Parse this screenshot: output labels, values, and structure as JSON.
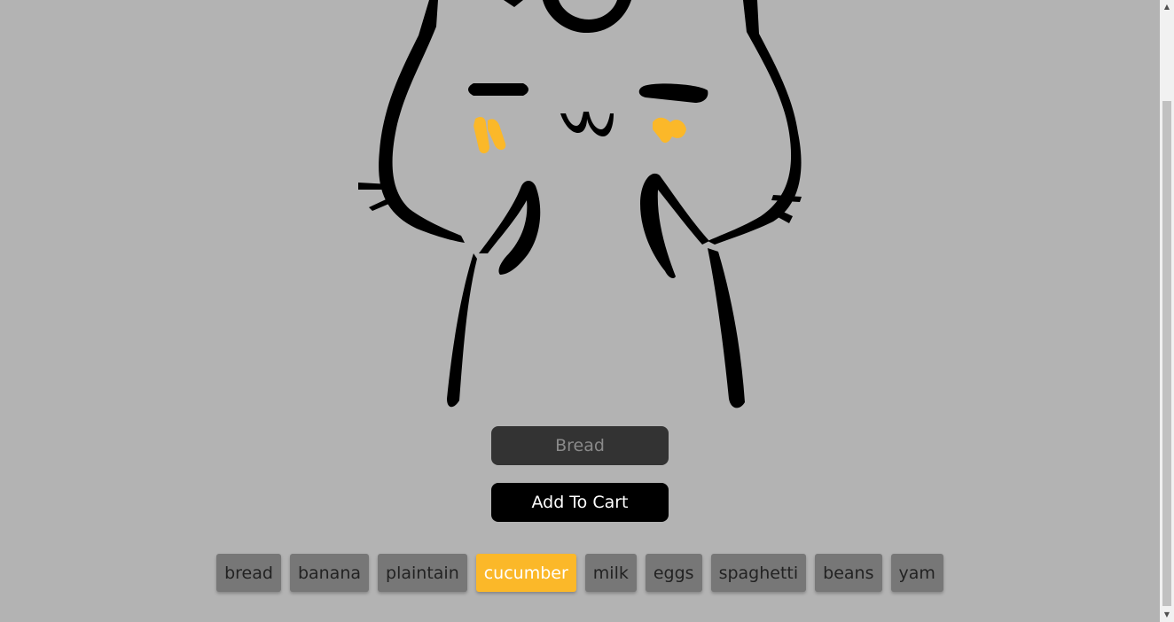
{
  "form": {
    "input_placeholder": "Bread",
    "input_value": "",
    "add_button_label": "Add To Cart"
  },
  "items": [
    {
      "label": "bread",
      "selected": false
    },
    {
      "label": "banana",
      "selected": false
    },
    {
      "label": "plaintain",
      "selected": false
    },
    {
      "label": "cucumber",
      "selected": true
    },
    {
      "label": "milk",
      "selected": false
    },
    {
      "label": "eggs",
      "selected": false
    },
    {
      "label": "spaghetti",
      "selected": false
    },
    {
      "label": "beans",
      "selected": false
    },
    {
      "label": "yam",
      "selected": false
    }
  ],
  "colors": {
    "background": "#b3b3b3",
    "accent": "#fbb829",
    "chip": "#777777",
    "input": "#333333",
    "button": "#000000"
  },
  "icons": {
    "scroll_up": "scroll-up-arrow-icon",
    "scroll_down": "scroll-down-arrow-icon",
    "illustration": "cat-mascot-drawing"
  }
}
